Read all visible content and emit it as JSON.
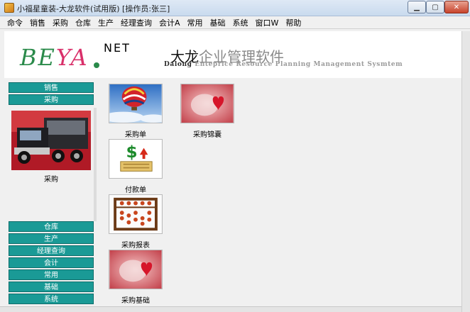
{
  "window": {
    "title": "小福星童装-大龙软件(试用版) [操作员:张三]",
    "min_glyph": "▁",
    "max_glyph": "▢",
    "close_glyph": "✕"
  },
  "menu": [
    "命令",
    "销售",
    "采购",
    "仓库",
    "生产",
    "经理查询",
    "会计A",
    "常用",
    "基础",
    "系统",
    "窗口W",
    "帮助"
  ],
  "banner": {
    "logo_be": "BE",
    "logo_y": "YA",
    "logo_net": "NET",
    "brand_cn_first": "大龙",
    "brand_cn_rest": "企业管理软件",
    "brand_en_first": "Dalong",
    "brand_en_rest": " Enteprice Resource Planning Management Sysmtem"
  },
  "left_nav": {
    "top_buttons": [
      "销售",
      "采购"
    ],
    "panel_caption": "采购",
    "bottom_buttons": [
      "仓库",
      "生产",
      "经理查询",
      "会计",
      "常用",
      "基础",
      "系统"
    ]
  },
  "tiles": [
    {
      "label": "采购单",
      "icon": "balloon-icon"
    },
    {
      "label": "采购锦囊",
      "icon": "heart-icon"
    },
    {
      "label": "付款单",
      "icon": "money-icon"
    },
    {
      "label": "采购报表",
      "icon": "abacus-icon"
    },
    {
      "label": "采购基础",
      "icon": "heart-icon"
    }
  ],
  "colors": {
    "nav_button": "#1a9a96",
    "logo_green": "#2a8a4a",
    "logo_pink": "#d9306a"
  }
}
